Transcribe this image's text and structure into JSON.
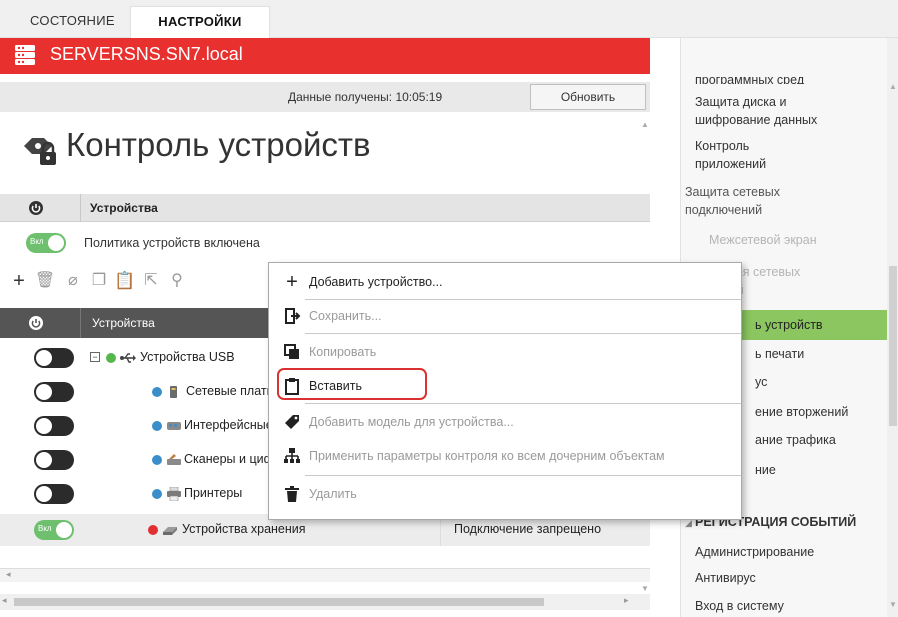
{
  "tabs": {
    "state": "СОСТОЯНИЕ",
    "settings": "НАСТРОЙКИ"
  },
  "server": {
    "name": "SERVERSNS.SN7.local",
    "icon": "server-icon",
    "color": "#e8312f"
  },
  "toolbar_top": {
    "received_label": "Данные получены: 10:05:19",
    "refresh_label": "Обновить"
  },
  "page": {
    "title": "Контроль устройств",
    "icon": "device-control-icon"
  },
  "devices_section": {
    "header": "Устройства",
    "policy_label": "Политика устройств включена",
    "policy_toggle": "Вкл"
  },
  "grid": {
    "header": "Устройства",
    "rows": [
      {
        "name": "Устройства USB",
        "enabled": false,
        "icon": "usb-icon"
      },
      {
        "name": "Сетевые плать",
        "enabled": false,
        "icon": "network-card-icon"
      },
      {
        "name": "Интерфейсные",
        "enabled": false,
        "icon": "interface-icon"
      },
      {
        "name": "Сканеры и циф",
        "enabled": false,
        "icon": "scanner-icon"
      },
      {
        "name": "Принтеры",
        "enabled": false,
        "icon": "printer-icon"
      },
      {
        "name": "Устройства хранения",
        "enabled": true,
        "toggle_text": "Вкл",
        "icon": "storage-icon",
        "status": "Подключение запрещено"
      }
    ]
  },
  "context_menu": {
    "items": [
      {
        "label": "Добавить устройство...",
        "icon": "plus-icon",
        "enabled": true
      },
      {
        "label": "Сохранить...",
        "icon": "save-icon",
        "enabled": false
      },
      {
        "label": "Копировать",
        "icon": "copy-icon",
        "enabled": false
      },
      {
        "label": "Вставить",
        "icon": "paste-icon",
        "enabled": true
      },
      {
        "label": "Добавить модель для устройства...",
        "icon": "tag-icon",
        "enabled": false
      },
      {
        "label": "Применить параметры контроля ко всем дочерним объектам",
        "icon": "hierarchy-icon",
        "enabled": false
      },
      {
        "label": "Удалить",
        "icon": "trash-icon",
        "enabled": false
      }
    ]
  },
  "right_nav": {
    "items": [
      {
        "label": "программных сред",
        "type": "sub"
      },
      {
        "label": "Защита диска и",
        "type": "sub"
      },
      {
        "label": "шифрование данных",
        "type": "sub"
      },
      {
        "label": "Контроль",
        "type": "sub"
      },
      {
        "label": "приложений",
        "type": "sub"
      },
      {
        "label": "Защита сетевых",
        "type": "grp"
      },
      {
        "label": "подключений",
        "type": "grp"
      },
      {
        "label": "Межсетевой экран",
        "type": "dim"
      },
      {
        "label": "изация сетевых",
        "type": "dim"
      },
      {
        "label": "нений",
        "type": "dim"
      },
      {
        "label": "ь устройств",
        "type": "active"
      },
      {
        "label": "ь печати",
        "type": "sub"
      },
      {
        "label": "ус",
        "type": "sub"
      },
      {
        "label": "ение вторжений",
        "type": "sub"
      },
      {
        "label": "ание трафика",
        "type": "sub"
      },
      {
        "label": "ние",
        "type": "sub"
      },
      {
        "label": "РЕГИСТРАЦИЯ СОБЫТИЙ",
        "type": "sect"
      },
      {
        "label": "Администрирование",
        "type": "sub"
      },
      {
        "label": "Антивирус",
        "type": "sub"
      },
      {
        "label": "Вход в систему",
        "type": "sub"
      }
    ],
    "active_color": "#8bc660"
  },
  "colors": {
    "accent_red": "#e8312f",
    "toggle_on": "#6ec06e",
    "highlight": "#d9312f"
  }
}
